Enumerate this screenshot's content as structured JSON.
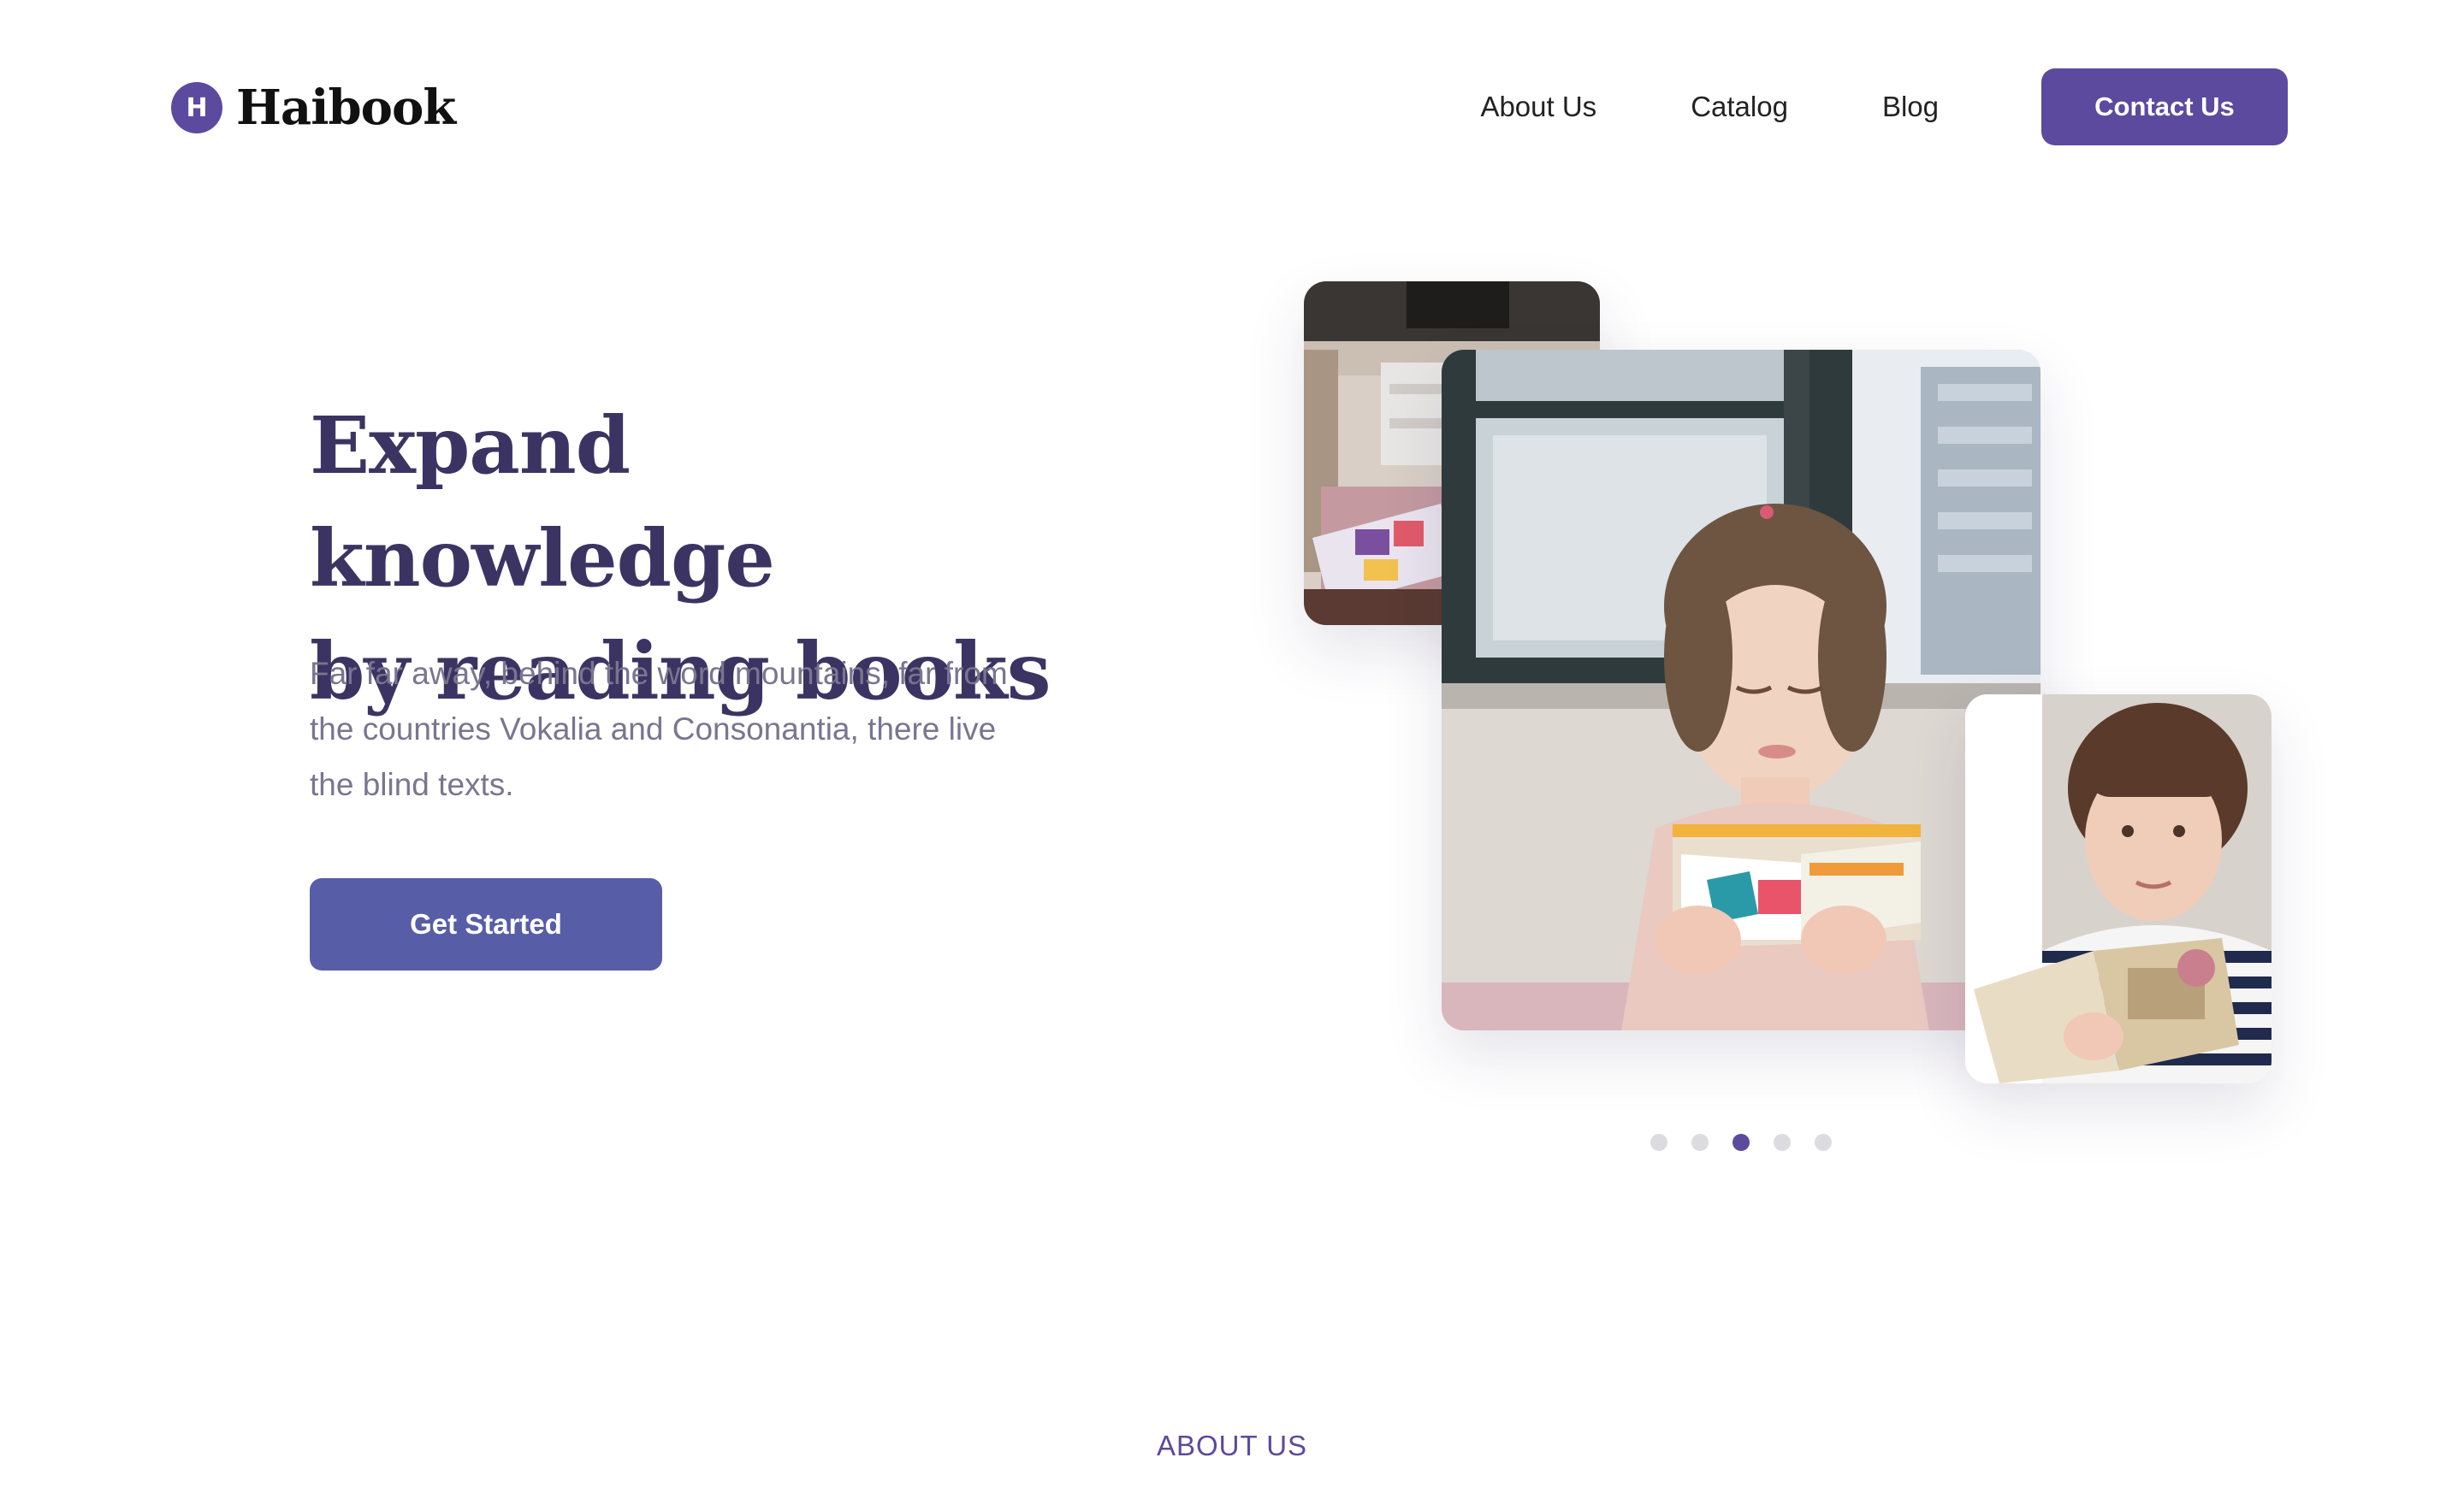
{
  "header": {
    "logo_letter": "H",
    "brand": "Haibook",
    "nav": [
      {
        "label": "About Us"
      },
      {
        "label": "Catalog"
      },
      {
        "label": "Blog"
      }
    ],
    "contact_label": "Contact Us"
  },
  "hero": {
    "title_line1": "Expand knowledge",
    "title_line2": "by reading books",
    "description": "Far far away, behind the word mountains, far from the countries Vokalia and Consonantia, there live the blind texts.",
    "cta_label": "Get Started"
  },
  "images": [
    {
      "icon": "photo-child-reading-picture-book"
    },
    {
      "icon": "photo-girl-reading-book-by-window"
    },
    {
      "icon": "photo-boy-holding-book"
    }
  ],
  "carousel": {
    "slide_count": 5,
    "active_index": 2
  },
  "about_section": {
    "label": "ABOUT US"
  },
  "colors": {
    "accent": "#5b4a9e",
    "button": "#575da6",
    "title": "#3b3463",
    "body_text": "#7a7590"
  }
}
